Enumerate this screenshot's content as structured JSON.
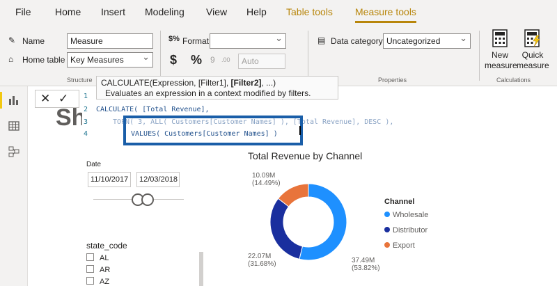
{
  "menu": [
    "File",
    "Home",
    "Insert",
    "Modeling",
    "View",
    "Help"
  ],
  "context_tabs": [
    "Table tools",
    "Measure tools"
  ],
  "structure": {
    "name_label": "Name",
    "name_value": "Measure",
    "home_table_label": "Home table",
    "home_table_value": "Key Measures",
    "group_label": "Structure"
  },
  "formatting": {
    "format_label": "Format",
    "format_value": "",
    "currency_symbol": "$",
    "percent_symbol": "%",
    "comma_symbol": "9",
    "decimal_symbol": ".00",
    "decimal_value": "Auto"
  },
  "properties": {
    "data_category_label": "Data category",
    "data_category_value": "Uncategorized",
    "group_label": "Properties"
  },
  "calculations": {
    "new_measure_line1": "New",
    "new_measure_line2": "measure",
    "quick_measure_line1": "Quick",
    "quick_measure_line2": "measure",
    "group_label": "Calculations"
  },
  "tooltip": {
    "signature_start": "CALCULATE(Expression, [Filter1], ",
    "signature_bold": "[Filter2]",
    "signature_end": ", ...)",
    "description": "Evaluates an expression in a context modified by filters."
  },
  "editor": {
    "line_numbers": [
      "1",
      "2",
      "3",
      "4"
    ],
    "line2": "CALCULATE( [Total Revenue],",
    "line3": "TOPN( 3, ALL( Customers[Customer Names] ), [Total Revenue], DESC ),",
    "line4": "VALUES( Customers[Customer Names] )"
  },
  "page_title": "Sh",
  "date_slicer": {
    "title": "Date",
    "start": "11/10/2017",
    "end": "12/03/2018"
  },
  "state_slicer": {
    "title": "state_code",
    "items": [
      "AL",
      "AR",
      "AZ"
    ]
  },
  "chart_data": {
    "type": "pie",
    "title": "Total Revenue by Channel",
    "legend_title": "Channel",
    "legend_position": "right",
    "categories": [
      "Wholesale",
      "Distributor",
      "Export"
    ],
    "values": [
      37.49,
      22.07,
      10.09
    ],
    "value_labels": [
      "37.49M",
      "22.07M",
      "10.09M"
    ],
    "percent_labels": [
      "(53.82%)",
      "(31.68%)",
      "(14.49%)"
    ],
    "colors": [
      "#1e90ff",
      "#1a2f9e",
      "#e8743b"
    ]
  }
}
